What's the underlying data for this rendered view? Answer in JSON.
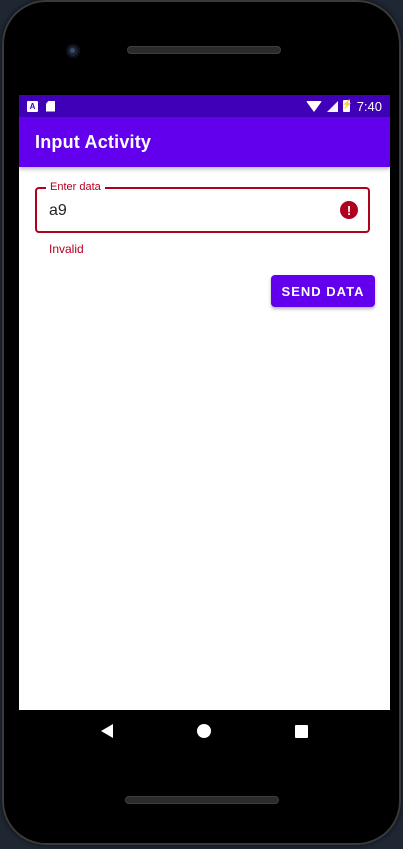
{
  "app": {
    "title": "Input Activity"
  },
  "statusbar": {
    "time": "7:40",
    "left_icon": "A",
    "icons": [
      "notification-a-icon",
      "sd-card-icon",
      "wifi-icon",
      "cell-signal-icon",
      "battery-charging-icon"
    ]
  },
  "form": {
    "label": "Enter data",
    "value": "a9",
    "helper": "Invalid",
    "error_icon": "!",
    "button_label": "SEND DATA"
  },
  "colors": {
    "primary": "#6200ee",
    "primary_dark": "#3f00b8",
    "error": "#b00020"
  }
}
